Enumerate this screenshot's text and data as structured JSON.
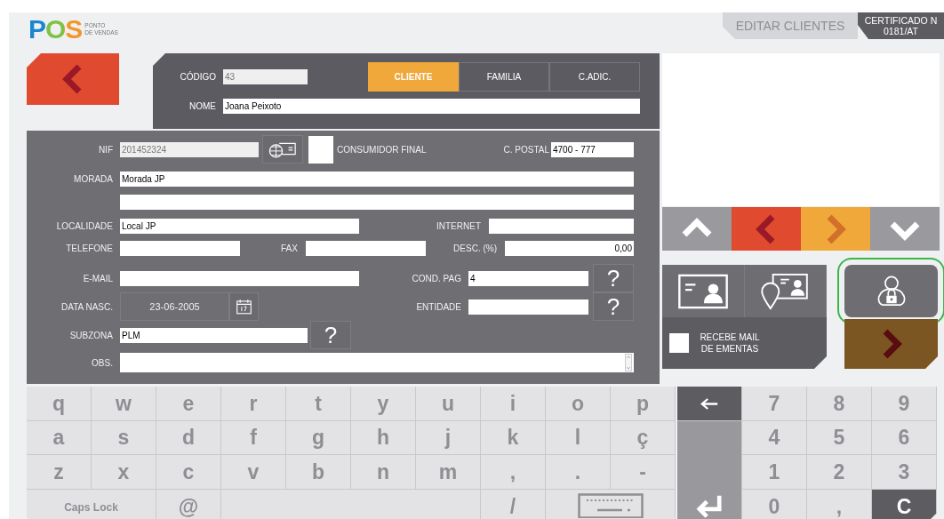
{
  "logo": {
    "brand": "POS",
    "tagline": [
      "PONTO",
      "DE VENDAS"
    ]
  },
  "page_title": "EDITAR CLIENTES",
  "certificate": [
    "CERTIFICADO N",
    "0181/AT"
  ],
  "record": {
    "codigo_label": "CÓDIGO",
    "codigo_value": "43",
    "nome_label": "NOME",
    "nome_value": "Joana Peixoto"
  },
  "tabs": [
    {
      "label": "CLIENTE",
      "selected": true
    },
    {
      "label": "FAMILIA",
      "selected": false
    },
    {
      "label": "C.ADIC.",
      "selected": false
    }
  ],
  "form": {
    "nif": {
      "label": "NIF",
      "value": "201452324"
    },
    "consumidor_final": {
      "label": "CONSUMIDOR FINAL",
      "checked": false
    },
    "codigo_postal": {
      "label": "C. POSTAL",
      "value": "4700 - 777"
    },
    "morada": {
      "label": "MORADA",
      "value": "Morada JP"
    },
    "localidade": {
      "label": "LOCALIDADE",
      "value": "Local JP"
    },
    "internet": {
      "label": "INTERNET"
    },
    "telefone": {
      "label": "TELEFONE"
    },
    "fax": {
      "label": "FAX"
    },
    "desconto": {
      "label": "DESC. (%)",
      "value": "0,00"
    },
    "email": {
      "label": "E-MAIL"
    },
    "cond_pag": {
      "label": "COND. PAG",
      "value": "4",
      "help": "?"
    },
    "data_nasc": {
      "label": "DATA NASC.",
      "value": "23-06-2005"
    },
    "entidade": {
      "label": "ENTIDADE",
      "help": "?"
    },
    "subzona": {
      "label": "SUBZONA",
      "value": "PLM",
      "help": "?"
    },
    "obs": {
      "label": "OBS."
    }
  },
  "recebe_mail": {
    "label": "RECEBE MAIL DE EMENTAS",
    "checked": false
  },
  "lock_button": {
    "focused": true
  },
  "keyboard": {
    "rows": [
      [
        "q",
        "w",
        "e",
        "r",
        "t",
        "y",
        "u",
        "i",
        "o",
        "p"
      ],
      [
        "a",
        "s",
        "d",
        "f",
        "g",
        "h",
        "j",
        "k",
        "l",
        "ç"
      ],
      [
        "z",
        "x",
        "c",
        "v",
        "b",
        "n",
        "m",
        ",",
        ".",
        "-"
      ]
    ],
    "bottom": [
      {
        "kind": "caps",
        "label": "Caps Lock"
      },
      {
        "kind": "key",
        "label": "@"
      },
      {
        "kind": "space"
      },
      {
        "kind": "key",
        "label": "/"
      },
      {
        "kind": "hide"
      }
    ]
  },
  "numpad": {
    "rows": [
      [
        "7",
        "8",
        "9"
      ],
      [
        "4",
        "5",
        "6"
      ],
      [
        "1",
        "2",
        "3"
      ],
      [
        "0",
        ","
      ]
    ],
    "clear": "C"
  }
}
